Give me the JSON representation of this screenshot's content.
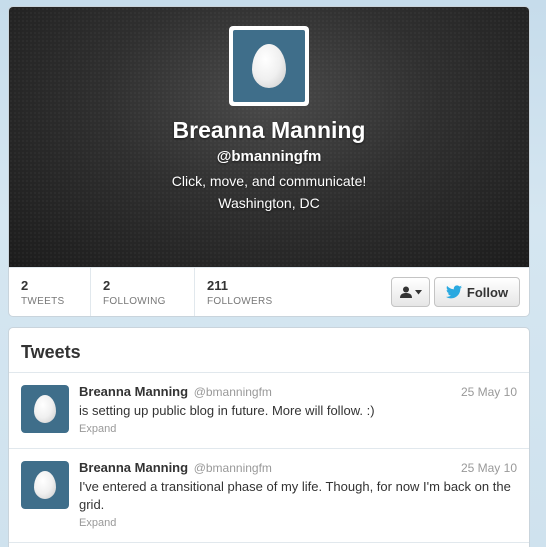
{
  "profile": {
    "name": "Breanna Manning",
    "handle": "@bmanningfm",
    "bio": "Click, move, and communicate!",
    "location": "Washington, DC",
    "avatar_icon": "egg-avatar-icon",
    "avatar_bg": "#3f6e8a"
  },
  "stats": [
    {
      "value": "2",
      "label": "TWEETS"
    },
    {
      "value": "2",
      "label": "FOLLOWING"
    },
    {
      "value": "211",
      "label": "FOLLOWERS"
    }
  ],
  "actions": {
    "follow_label": "Follow",
    "follow_icon": "twitter-bird-icon",
    "user_menu_icon": "user-dropdown-icon",
    "accent": "#1da1f2"
  },
  "tweets": {
    "title": "Tweets",
    "items": [
      {
        "name": "Breanna Manning",
        "handle": "@bmanningfm",
        "date": "25 May 10",
        "text": "is setting up public blog in future. More will follow. :)",
        "expand": "Expand"
      },
      {
        "name": "Breanna Manning",
        "handle": "@bmanningfm",
        "date": "25 May 10",
        "text": "I've entered a transitional phase of my life. Though, for now I'm back on the grid.",
        "expand": "Expand"
      }
    ]
  }
}
